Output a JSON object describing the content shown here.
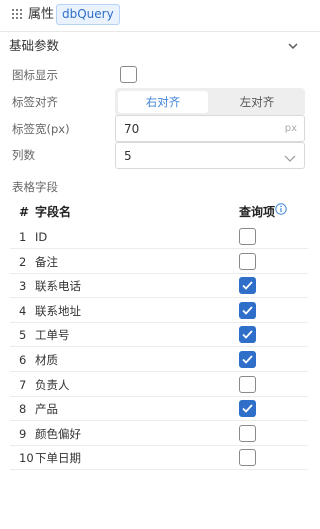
{
  "header": {
    "title": "属性",
    "tag": "dbQuery"
  },
  "section": {
    "title": "基础参数"
  },
  "fields": {
    "icon_display": {
      "label": "图标显示",
      "checked": false
    },
    "label_align": {
      "label": "标签对齐",
      "options": [
        "右对齐",
        "左对齐"
      ],
      "selected": "右对齐"
    },
    "label_width": {
      "label": "标签宽(px)",
      "value": "70",
      "unit": "px"
    },
    "columns": {
      "label": "列数",
      "value": "5"
    }
  },
  "table": {
    "label": "表格字段",
    "headers": {
      "index": "#",
      "name": "字段名",
      "query": "查询项"
    },
    "rows": [
      {
        "index": "1",
        "name": "ID",
        "query": false
      },
      {
        "index": "2",
        "name": "备注",
        "query": false
      },
      {
        "index": "3",
        "name": "联系电话",
        "query": true
      },
      {
        "index": "4",
        "name": "联系地址",
        "query": true
      },
      {
        "index": "5",
        "name": "工单号",
        "query": true
      },
      {
        "index": "6",
        "name": "材质",
        "query": true
      },
      {
        "index": "7",
        "name": "负责人",
        "query": false
      },
      {
        "index": "8",
        "name": "产品",
        "query": true
      },
      {
        "index": "9",
        "name": "颜色偏好",
        "query": false
      },
      {
        "index": "10",
        "name": "下单日期",
        "query": false
      }
    ]
  },
  "colors": {
    "accent": "#2f6fc9",
    "tag_bg": "#eaf3fd",
    "tag_text": "#2d6fc8"
  },
  "icons": {
    "grip": "drag-grip-icon",
    "collapse": "chevron-down-icon",
    "select": "chevron-down-icon",
    "info": "info-icon",
    "check": "check-icon"
  }
}
